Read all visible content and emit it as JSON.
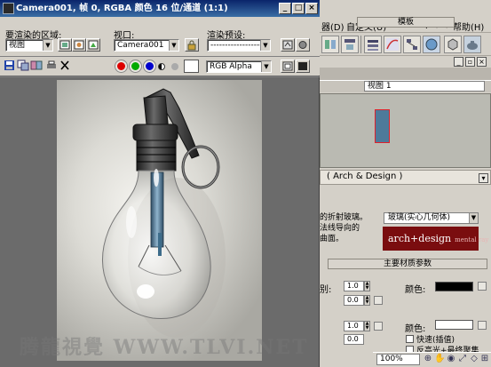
{
  "render_window": {
    "title": "Camera001, 帧 0, RGBA 颜色 16 位/通道 (1:1)",
    "area_label": "要渲染的区域:",
    "area_value": "视图",
    "viewport_label": "视口:",
    "viewport_value": "Camera001",
    "preset_label": "渲染预设:",
    "preset_value": "-------------------",
    "channel_value": "RGB Alpha"
  },
  "main_window": {
    "menu": [
      "器(D)",
      "自定义(U)",
      "MAXScript(M)",
      "帮助(H)"
    ],
    "view_select": "视图 1",
    "material_label": "( Arch & Design )",
    "templates_header": "模板",
    "template_desc": [
      "的折射玻璃。",
      "法线导向的",
      "曲面。"
    ],
    "template_value": "玻璃(实心几何体)",
    "logo_main": "arch+design",
    "logo_sub": "mental ray",
    "main_params_header": "主要材质参数",
    "param_label_1": "别:",
    "spin_1": "1.0",
    "spin_2": "0.0",
    "color_label_1": "颜色:",
    "spin_3": "1.0",
    "spin_4": "0.0",
    "color_label_2": "颜色:",
    "check_1": "快速(插值)",
    "check_2": "反高光+最终聚集",
    "zoom_value": "100%"
  },
  "colors": {
    "title_blue": "#0a246a",
    "logo_red": "#7a0d0f",
    "swatch_black": "#000000",
    "swatch_white": "#ffffff"
  },
  "watermark": "腾龍視覺 WWW.TLVI.NET"
}
